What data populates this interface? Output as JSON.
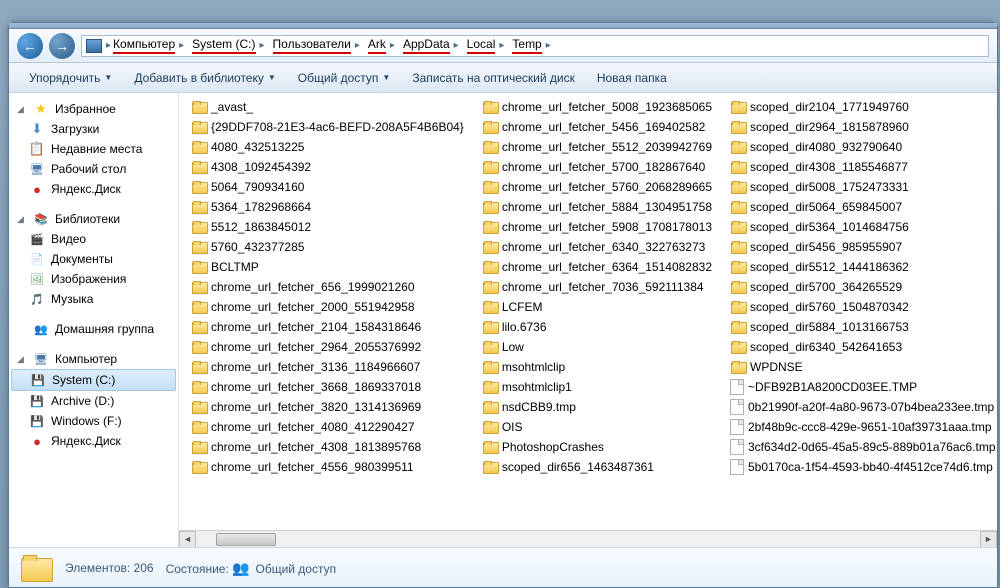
{
  "breadcrumbs": [
    "Компьютер",
    "System (C:)",
    "Пользователи",
    "Ark",
    "AppData",
    "Local",
    "Temp"
  ],
  "breadcrumbs_underlined": [
    true,
    true,
    true,
    true,
    true,
    true,
    true
  ],
  "toolbar": {
    "organize": "Упорядочить",
    "add_lib": "Добавить в библиотеку",
    "share": "Общий доступ",
    "burn": "Записать на оптический диск",
    "new_folder": "Новая папка"
  },
  "sidebar": {
    "favorites": {
      "head": "Избранное",
      "items": [
        "Загрузки",
        "Недавние места",
        "Рабочий стол",
        "Яндекс.Диск"
      ],
      "icons": [
        "ico-dl",
        "ico-recent",
        "ico-desk",
        "ico-ya"
      ]
    },
    "libraries": {
      "head": "Библиотеки",
      "items": [
        "Видео",
        "Документы",
        "Изображения",
        "Музыка"
      ],
      "icons": [
        "ico-vid",
        "ico-doc",
        "ico-img",
        "ico-mus"
      ]
    },
    "homegroup": {
      "head": "Домашняя группа"
    },
    "computer": {
      "head": "Компьютер",
      "items": [
        "System (C:)",
        "Archive (D:)",
        "Windows (F:)",
        "Яндекс.Диск"
      ],
      "icons": [
        "ico-drv",
        "ico-drv",
        "ico-drv",
        "ico-ya"
      ]
    }
  },
  "selected_sidebar": "System (C:)",
  "columns": [
    {
      "type": "folder",
      "items": [
        "_avast_",
        "{29DDF708-21E3-4ac6-BEFD-208A5F4B6B04}",
        "4080_432513225",
        "4308_1092454392",
        "5064_790934160",
        "5364_1782968664",
        "5512_1863845012",
        "5760_432377285",
        "BCLTMP",
        "chrome_url_fetcher_656_1999021260",
        "chrome_url_fetcher_2000_551942958",
        "chrome_url_fetcher_2104_1584318646",
        "chrome_url_fetcher_2964_2055376992",
        "chrome_url_fetcher_3136_1184966607",
        "chrome_url_fetcher_3668_1869337018",
        "chrome_url_fetcher_3820_1314136969",
        "chrome_url_fetcher_4080_412290427",
        "chrome_url_fetcher_4308_1813895768",
        "chrome_url_fetcher_4556_980399511"
      ]
    },
    {
      "type": "folder",
      "items": [
        "chrome_url_fetcher_5008_1923685065",
        "chrome_url_fetcher_5456_169402582",
        "chrome_url_fetcher_5512_2039942769",
        "chrome_url_fetcher_5700_182867640",
        "chrome_url_fetcher_5760_2068289665",
        "chrome_url_fetcher_5884_1304951758",
        "chrome_url_fetcher_5908_1708178013",
        "chrome_url_fetcher_6340_322763273",
        "chrome_url_fetcher_6364_1514082832",
        "chrome_url_fetcher_7036_592111384",
        "LCFEM",
        "lilo.6736",
        "Low",
        "msohtmlclip",
        "msohtmlclip1",
        "nsdCBB9.tmp",
        "OIS",
        "PhotoshopCrashes",
        "scoped_dir656_1463487361"
      ]
    },
    {
      "type": "mixed",
      "items": [
        {
          "t": "folder",
          "n": "scoped_dir2104_1771949760"
        },
        {
          "t": "folder",
          "n": "scoped_dir2964_1815878960"
        },
        {
          "t": "folder",
          "n": "scoped_dir4080_932790640"
        },
        {
          "t": "folder",
          "n": "scoped_dir4308_1185546877"
        },
        {
          "t": "folder",
          "n": "scoped_dir5008_1752473331"
        },
        {
          "t": "folder",
          "n": "scoped_dir5064_659845007"
        },
        {
          "t": "folder",
          "n": "scoped_dir5364_1014684756"
        },
        {
          "t": "folder",
          "n": "scoped_dir5456_985955907"
        },
        {
          "t": "folder",
          "n": "scoped_dir5512_1444186362"
        },
        {
          "t": "folder",
          "n": "scoped_dir5700_364265529"
        },
        {
          "t": "folder",
          "n": "scoped_dir5760_1504870342"
        },
        {
          "t": "folder",
          "n": "scoped_dir5884_1013166753"
        },
        {
          "t": "folder",
          "n": "scoped_dir6340_542641653"
        },
        {
          "t": "folder",
          "n": "WPDNSE"
        },
        {
          "t": "file",
          "n": "~DFB92B1A8200CD03EE.TMP"
        },
        {
          "t": "file",
          "n": "0b21990f-a20f-4a80-9673-07b4bea233ee.tmp"
        },
        {
          "t": "file",
          "n": "2bf48b9c-ccc8-429e-9651-10af39731aaa.tmp"
        },
        {
          "t": "file",
          "n": "3cf634d2-0d65-45a5-89c5-889b01a76ac6.tmp"
        },
        {
          "t": "file",
          "n": "5b0170ca-1f54-4593-bb40-4f4512ce74d6.tmp"
        }
      ]
    }
  ],
  "partial_col_count": 19,
  "status": {
    "count_label": "Элементов:",
    "count": "206",
    "state_label": "Состояние:",
    "share": "Общий доступ"
  }
}
